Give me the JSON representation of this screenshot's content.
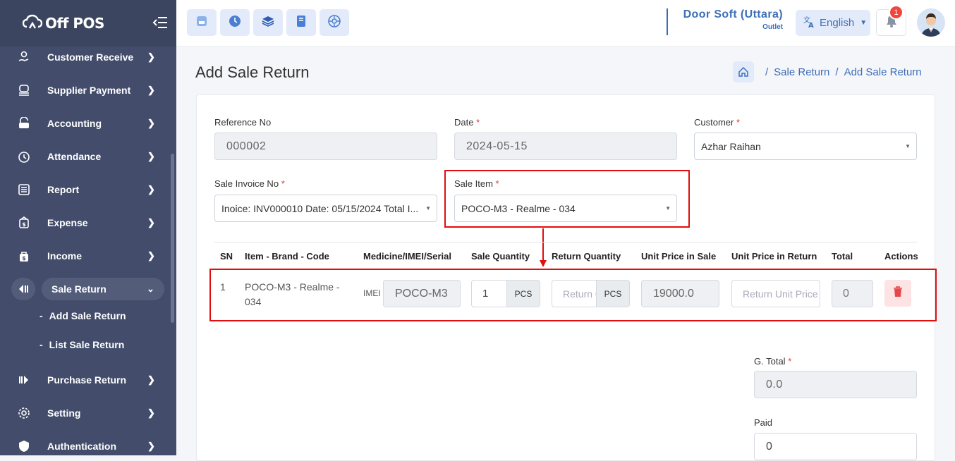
{
  "app": {
    "logo_text": "Off POS"
  },
  "sidebar": {
    "items": [
      {
        "label": "Customer Receive",
        "icon": "hand-coin-icon"
      },
      {
        "label": "Supplier Payment",
        "icon": "cash-icon"
      },
      {
        "label": "Accounting",
        "icon": "wallet-icon"
      },
      {
        "label": "Attendance",
        "icon": "clock-icon"
      },
      {
        "label": "Report",
        "icon": "list-icon"
      },
      {
        "label": "Expense",
        "icon": "money-icon"
      },
      {
        "label": "Income",
        "icon": "bag-icon"
      },
      {
        "label": "Sale Return",
        "icon": "return-icon"
      },
      {
        "label": "Purchase Return",
        "icon": "forward-icon"
      },
      {
        "label": "Setting",
        "icon": "gear-icon"
      },
      {
        "label": "Authentication",
        "icon": "shield-icon"
      }
    ],
    "sub_items": [
      {
        "label": "Add Sale Return"
      },
      {
        "label": "List Sale Return"
      }
    ]
  },
  "topbar": {
    "outlet_name": "Door Soft (Uttara)",
    "outlet_label": "Outlet",
    "language": "English",
    "notification_count": "1",
    "quick_icons": [
      "pos-icon",
      "clock-icon",
      "layers-icon",
      "tablet-icon",
      "dashboard-icon"
    ]
  },
  "page": {
    "title": "Add Sale Return",
    "breadcrumb": [
      "Sale Return",
      "Add Sale Return"
    ]
  },
  "form": {
    "reference_no": {
      "label": "Reference No",
      "value": "000002"
    },
    "date": {
      "label": "Date",
      "value": "2024-05-15"
    },
    "customer": {
      "label": "Customer",
      "value": "Azhar Raihan"
    },
    "sale_invoice_no": {
      "label": "Sale Invoice No",
      "value": "Inoice: INV000010 Date: 05/15/2024 Total I..."
    },
    "sale_item": {
      "label": "Sale Item",
      "value": "POCO-M3 - Realme - 034"
    },
    "required_mark": "*"
  },
  "table": {
    "headers": [
      "SN",
      "Item - Brand - Code",
      "Medicine/IMEI/Serial",
      "Sale Quantity",
      "Return Quantity",
      "Unit Price in Sale",
      "Unit Price in Return",
      "Total",
      "Actions"
    ],
    "row": {
      "sn": "1",
      "item_line1": "POCO-M3 - Realme -",
      "item_line2": "034",
      "imei_label": "IMEI",
      "imei_value": "POCO-M3",
      "sale_qty": "1",
      "sale_unit": "PCS",
      "return_qty_placeholder": "Return Quantity",
      "return_unit": "PCS",
      "unit_price_sale": "19000.0",
      "unit_price_return_placeholder": "Return Unit Price",
      "total": "0"
    }
  },
  "totals": {
    "g_total": {
      "label": "G. Total",
      "value": "0.0"
    },
    "paid": {
      "label": "Paid",
      "value": "0"
    }
  },
  "colors": {
    "accent": "#3d6fb8",
    "sidebar": "#434d6b",
    "highlight": "#e20d0d"
  }
}
